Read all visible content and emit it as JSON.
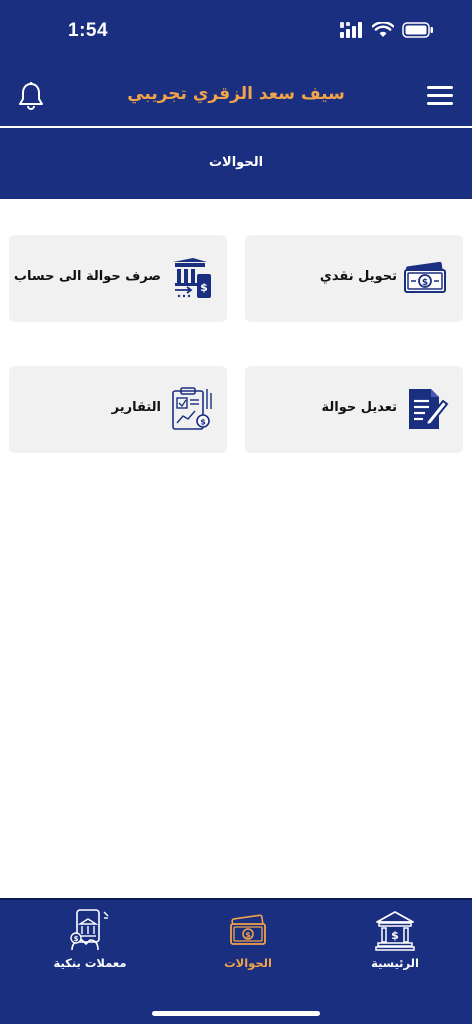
{
  "status": {
    "time": "1:54"
  },
  "header": {
    "title": "سيف سعد الزقري تجريبي"
  },
  "section": {
    "title": "الحوالات"
  },
  "cards": [
    {
      "label": "تحويل نقدي",
      "icon": "cash-money-icon"
    },
    {
      "label": "صرف حوالة الى حساب",
      "icon": "bank-transfer-icon"
    },
    {
      "label": "تعديل حوالة",
      "icon": "edit-document-icon"
    },
    {
      "label": "التقارير",
      "icon": "report-clipboard-icon"
    }
  ],
  "nav": {
    "items": [
      {
        "label": "الرئيسية",
        "icon": "bank-building-icon",
        "active": false
      },
      {
        "label": "الحوالات",
        "icon": "cash-money-icon",
        "active": true
      },
      {
        "label": "معملات بنكية",
        "icon": "bank-phone-icon",
        "active": false
      }
    ]
  },
  "colors": {
    "primary": "#1b2f80",
    "accent": "#f0a34a",
    "card": "#f1f1f2"
  }
}
